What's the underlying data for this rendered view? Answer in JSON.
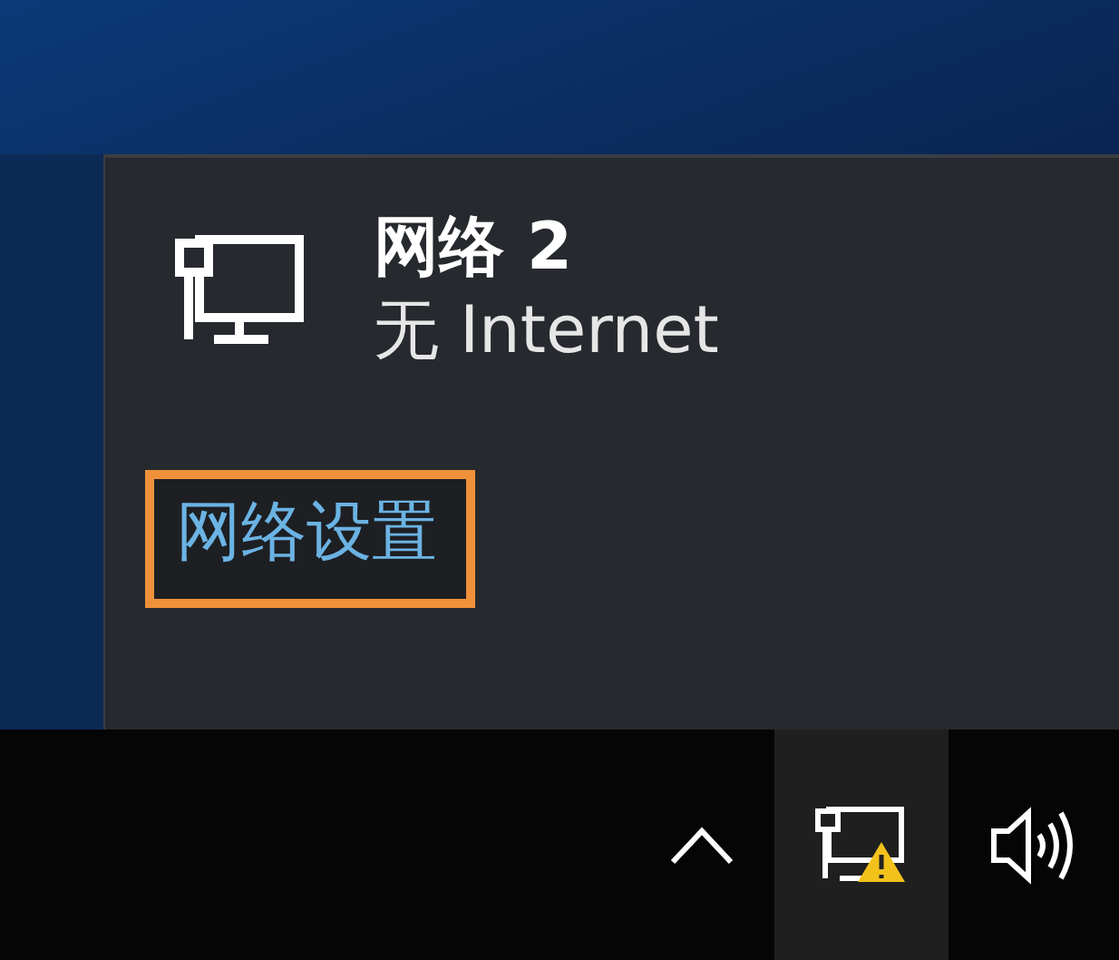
{
  "network": {
    "name": "网络 2",
    "status": "无 Internet"
  },
  "settings_link": {
    "label": "网络设置",
    "highlighted": true
  },
  "tray": [
    {
      "kind": "chevron",
      "selected": false
    },
    {
      "kind": "network",
      "selected": true
    },
    {
      "kind": "volume",
      "selected": false
    }
  ]
}
